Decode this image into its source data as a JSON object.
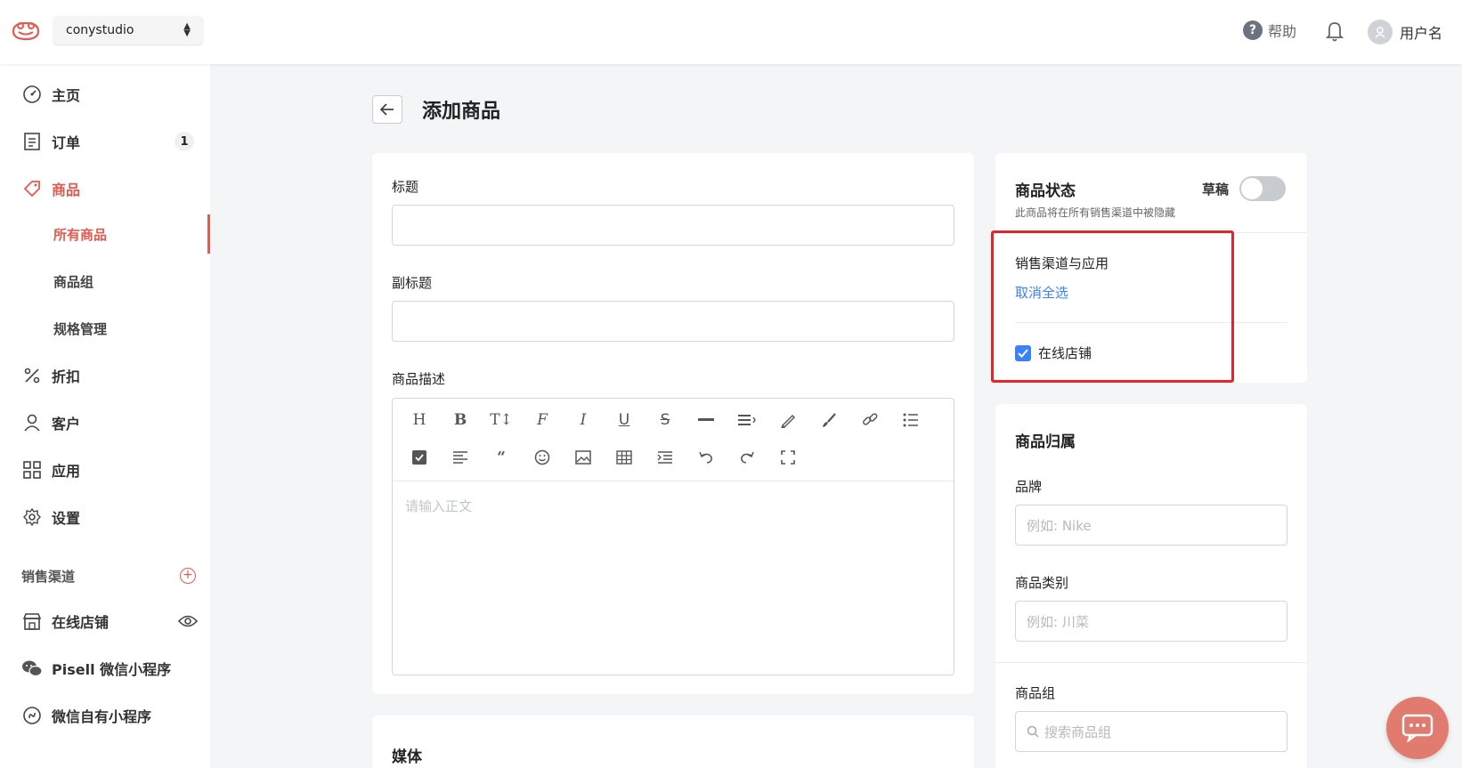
{
  "topbar": {
    "store_name": "conystudio",
    "help_label": "帮助",
    "username": "用户名"
  },
  "sidebar": {
    "items": [
      {
        "label": "主页",
        "icon": "dashboard-icon"
      },
      {
        "label": "订单",
        "icon": "order-icon",
        "badge": "1"
      },
      {
        "label": "商品",
        "icon": "tag-icon"
      },
      {
        "label": "折扣",
        "icon": "percent-icon"
      },
      {
        "label": "客户",
        "icon": "user-icon"
      },
      {
        "label": "应用",
        "icon": "apps-icon"
      },
      {
        "label": "设置",
        "icon": "gear-icon"
      }
    ],
    "sub_items": [
      {
        "label": "所有商品"
      },
      {
        "label": "商品组"
      },
      {
        "label": "规格管理"
      }
    ],
    "channels_title": "销售渠道",
    "channels": [
      {
        "label": "在线店铺"
      },
      {
        "label": "Pisell 微信小程序"
      },
      {
        "label": "微信自有小程序"
      }
    ]
  },
  "main": {
    "title": "添加商品",
    "form": {
      "title_label": "标题",
      "subtitle_label": "副标题",
      "description_label": "商品描述",
      "editor_placeholder": "请输入正文",
      "media_label": "媒体"
    },
    "status": {
      "title": "商品状态",
      "subtitle": "此商品将在所有销售渠道中被隐藏",
      "draft_label": "草稿",
      "published": false
    },
    "channels": {
      "title": "销售渠道与应用",
      "deselect_all": "取消全选",
      "online_store_label": "在线店铺",
      "online_store_checked": true
    },
    "ownership": {
      "title": "商品归属",
      "brand_label": "品牌",
      "brand_placeholder": "例如: Nike",
      "category_label": "商品类别",
      "category_placeholder": "例如: 川菜",
      "group_label": "商品组",
      "group_placeholder": "搜索商品组"
    }
  },
  "colors": {
    "accent": "#e5594f",
    "link": "#3b82f6",
    "highlight": "#e5252a"
  }
}
